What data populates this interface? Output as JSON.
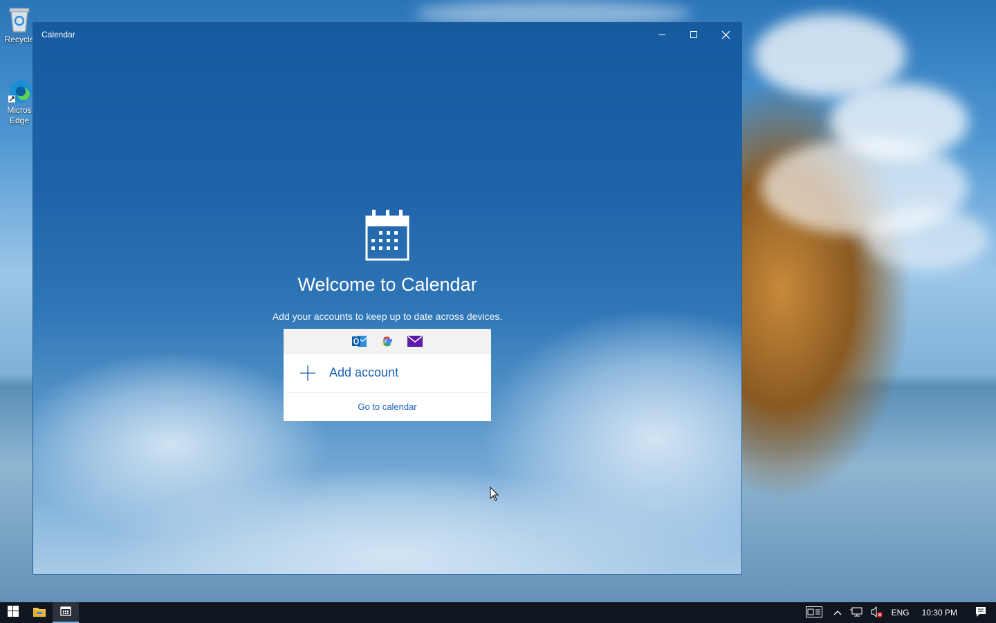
{
  "desktop": {
    "icons": [
      {
        "label": "Recycle",
        "icon": "recycle-bin-icon"
      },
      {
        "label": "Micros Edge",
        "icon": "edge-icon"
      }
    ]
  },
  "window": {
    "title": "Calendar",
    "controls": [
      "minimize-icon",
      "maximize-icon",
      "close-icon"
    ]
  },
  "welcome": {
    "icon": "calendar-icon",
    "heading": "Welcome to Calendar",
    "subtitle": "Add your accounts to keep up to date across devices."
  },
  "accounts_card": {
    "providers": [
      "outlook-icon",
      "google-icon",
      "mail-icon"
    ],
    "add_account_label": "Add account",
    "go_to_calendar_label": "Go to calendar"
  },
  "taskbar": {
    "apps": [
      "start-icon",
      "file-explorer-icon",
      "calendar-app-icon"
    ],
    "active_app": "calendar-app-icon",
    "tray": {
      "language": "ENG",
      "time": "10:30 PM"
    }
  },
  "colors": {
    "accent": "#1a5fb4",
    "window_top": "#165aa0",
    "taskbar": "#0f1620"
  }
}
